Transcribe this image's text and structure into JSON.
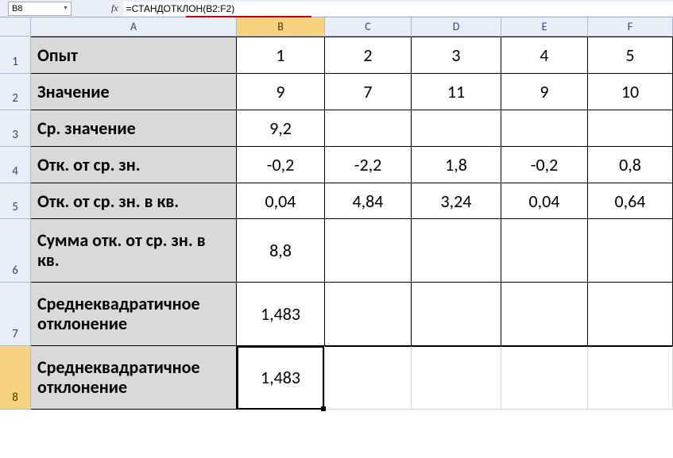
{
  "formula_bar": {
    "cell_ref": "B8",
    "fx_label": "fx",
    "formula": "=СТАНДОТКЛОН(B2:F2)"
  },
  "columns": [
    "A",
    "B",
    "C",
    "D",
    "E",
    "F"
  ],
  "row_numbers": [
    "1",
    "2",
    "3",
    "4",
    "5",
    "6",
    "7",
    "8"
  ],
  "selected_cell": {
    "col": "B",
    "row": "8"
  },
  "rows": {
    "r1": {
      "label": "Опыт",
      "cells": [
        "1",
        "2",
        "3",
        "4",
        "5"
      ]
    },
    "r2": {
      "label": "Значение",
      "cells": [
        "9",
        "7",
        "11",
        "9",
        "10"
      ]
    },
    "r3": {
      "label": "Ср. значение",
      "cells": [
        "9,2",
        "",
        "",
        "",
        ""
      ]
    },
    "r4": {
      "label": "Отк. от ср. зн.",
      "cells": [
        "-0,2",
        "-2,2",
        "1,8",
        "-0,2",
        "0,8"
      ]
    },
    "r5": {
      "label": "Отк. от ср. зн. в кв.",
      "cells": [
        "0,04",
        "4,84",
        "3,24",
        "0,04",
        "0,64"
      ]
    },
    "r6": {
      "label": "Сумма отк. от ср. зн. в кв.",
      "cells": [
        "8,8",
        "",
        "",
        "",
        ""
      ]
    },
    "r7": {
      "label": "Среднеквадратичное отклонение",
      "cells": [
        "1,483",
        "",
        "",
        "",
        ""
      ]
    },
    "r8": {
      "label": "Среднеквадратичное отклонение",
      "cells": [
        "1,483",
        "",
        "",
        "",
        ""
      ]
    }
  },
  "chart_data": {
    "type": "table",
    "title": "Standard deviation calculation",
    "experiments": [
      1,
      2,
      3,
      4,
      5
    ],
    "values": [
      9,
      7,
      11,
      9,
      10
    ],
    "mean": 9.2,
    "deviations": [
      -0.2,
      -2.2,
      1.8,
      -0.2,
      0.8
    ],
    "squared_deviations": [
      0.04,
      4.84,
      3.24,
      0.04,
      0.64
    ],
    "sum_squared_deviations": 8.8,
    "std_dev_manual": 1.483,
    "std_dev_function": 1.483,
    "formula_used": "=СТАНДОТКЛОН(B2:F2)"
  }
}
